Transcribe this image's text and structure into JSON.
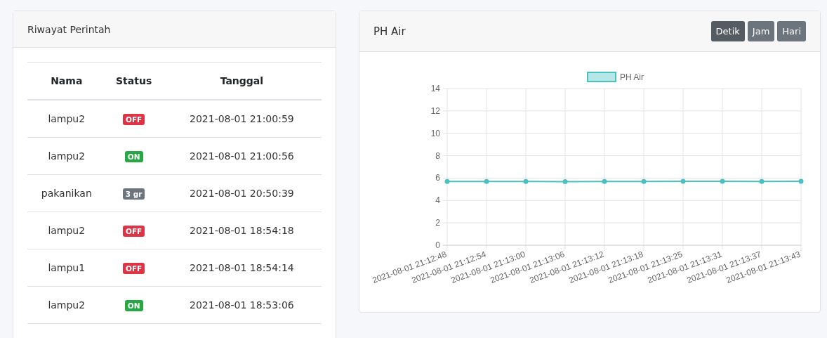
{
  "history_card": {
    "title": "Riwayat Perintah",
    "columns": [
      "Nama",
      "Status",
      "Tanggal"
    ],
    "rows": [
      {
        "name": "lampu2",
        "status": "OFF",
        "color": "#dc3545",
        "date": "2021-08-01 21:00:59"
      },
      {
        "name": "lampu2",
        "status": "ON",
        "color": "#28a745",
        "date": "2021-08-01 21:00:56"
      },
      {
        "name": "pakanikan",
        "status": "3 gr",
        "color": "#6c757d",
        "date": "2021-08-01 20:50:39"
      },
      {
        "name": "lampu2",
        "status": "OFF",
        "color": "#dc3545",
        "date": "2021-08-01 18:54:18"
      },
      {
        "name": "lampu1",
        "status": "OFF",
        "color": "#dc3545",
        "date": "2021-08-01 18:54:14"
      },
      {
        "name": "lampu2",
        "status": "ON",
        "color": "#28a745",
        "date": "2021-08-01 18:53:06"
      }
    ]
  },
  "chart_card": {
    "title": "PH Air",
    "buttons": [
      {
        "label": "Detik",
        "selected": true
      },
      {
        "label": "Jam",
        "selected": false
      },
      {
        "label": "Hari",
        "selected": false
      }
    ],
    "chart_data": {
      "type": "line",
      "categories": [
        "2021-08-01 21:12:48",
        "2021-08-01 21:12:54",
        "2021-08-01 21:13:00",
        "2021-08-01 21:13:06",
        "2021-08-01 21:13:12",
        "2021-08-01 21:13:18",
        "2021-08-01 21:13:25",
        "2021-08-01 21:13:31",
        "2021-08-01 21:13:37",
        "2021-08-01 21:13:43"
      ],
      "grid": true,
      "series": [
        {
          "name": "PH Air",
          "color": "#4bc0c0",
          "marker": "circle",
          "values": [
            5.7,
            5.7,
            5.7,
            5.68,
            5.7,
            5.7,
            5.72,
            5.72,
            5.7,
            5.72
          ]
        }
      ],
      "ylim": [
        0,
        14
      ],
      "yticks": [
        0,
        2,
        4,
        6,
        8,
        10,
        12,
        14
      ]
    }
  }
}
